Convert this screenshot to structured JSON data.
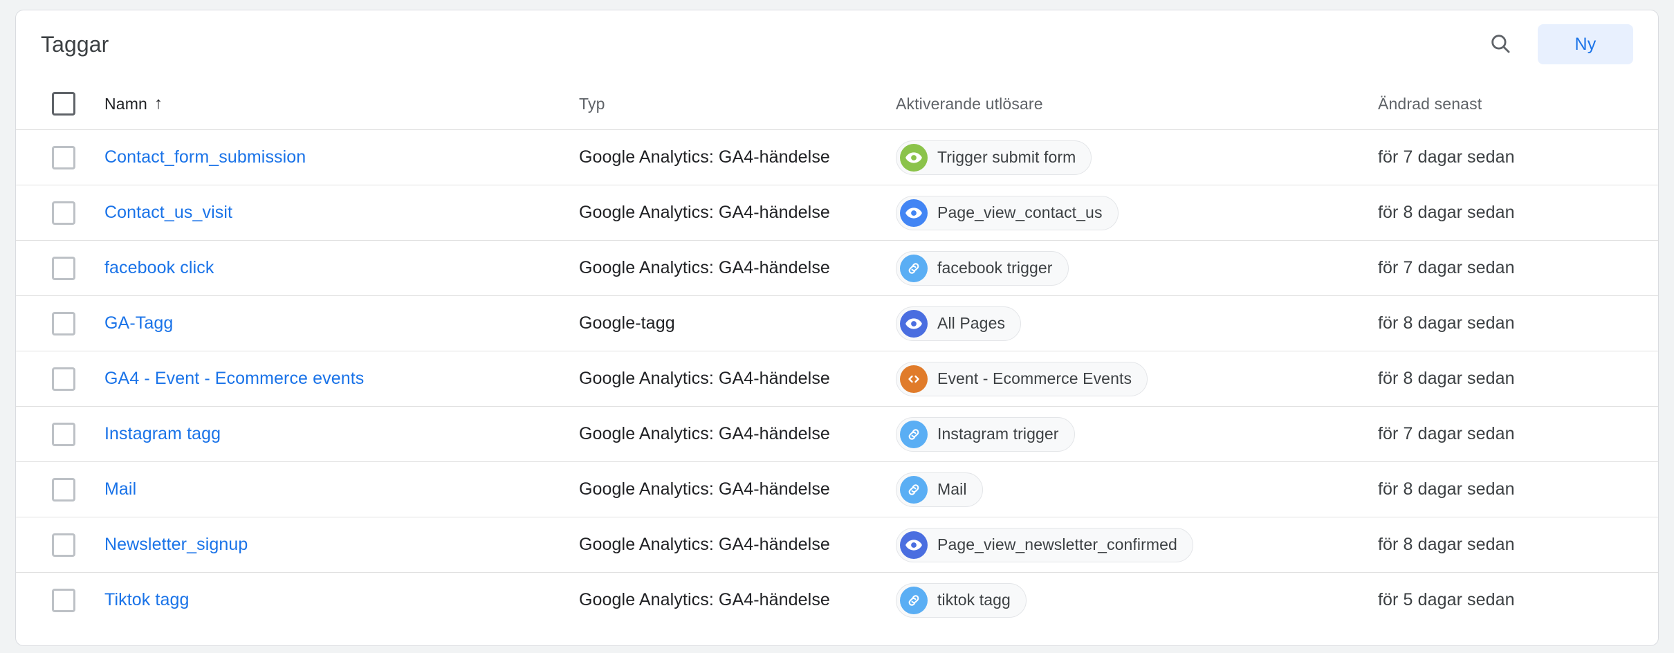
{
  "header": {
    "title": "Taggar",
    "search_icon": "search-icon",
    "new_button_label": "Ny"
  },
  "table": {
    "columns": {
      "name": "Namn",
      "type": "Typ",
      "trigger": "Aktiverande utlösare",
      "modified": "Ändrad senast"
    },
    "sort": {
      "column": "name",
      "direction": "asc",
      "arrow_glyph": "↑"
    },
    "select_all_checked": false,
    "rows": [
      {
        "name": "Contact_form_submission",
        "type": "Google Analytics: GA4-händelse",
        "trigger": {
          "label": "Trigger submit form",
          "icon": "eye-icon",
          "color": "#8bc34a"
        },
        "modified": "för 7 dagar sedan",
        "checked": false
      },
      {
        "name": "Contact_us_visit",
        "type": "Google Analytics: GA4-händelse",
        "trigger": {
          "label": "Page_view_contact_us",
          "icon": "eye-icon",
          "color": "#4285f4"
        },
        "modified": "för 8 dagar sedan",
        "checked": false
      },
      {
        "name": "facebook click",
        "type": "Google Analytics: GA4-händelse",
        "trigger": {
          "label": "facebook trigger",
          "icon": "link-icon",
          "color": "#5aaef4"
        },
        "modified": "för 7 dagar sedan",
        "checked": false
      },
      {
        "name": "GA-Tagg",
        "type": "Google-tagg",
        "trigger": {
          "label": "All Pages",
          "icon": "eye-icon",
          "color": "#4a6ee0"
        },
        "modified": "för 8 dagar sedan",
        "checked": false
      },
      {
        "name": "GA4 - Event - Ecommerce events",
        "type": "Google Analytics: GA4-händelse",
        "trigger": {
          "label": "Event - Ecommerce Events",
          "icon": "code-icon",
          "color": "#e07b2a"
        },
        "modified": "för 8 dagar sedan",
        "checked": false
      },
      {
        "name": "Instagram tagg",
        "type": "Google Analytics: GA4-händelse",
        "trigger": {
          "label": "Instagram trigger",
          "icon": "link-icon",
          "color": "#5aaef4"
        },
        "modified": "för 7 dagar sedan",
        "checked": false
      },
      {
        "name": "Mail",
        "type": "Google Analytics: GA4-händelse",
        "trigger": {
          "label": "Mail",
          "icon": "link-icon",
          "color": "#5aaef4"
        },
        "modified": "för 8 dagar sedan",
        "checked": false
      },
      {
        "name": "Newsletter_signup",
        "type": "Google Analytics: GA4-händelse",
        "trigger": {
          "label": "Page_view_newsletter_confirmed",
          "icon": "eye-icon",
          "color": "#4a6ee0"
        },
        "modified": "för 8 dagar sedan",
        "checked": false
      },
      {
        "name": "Tiktok tagg",
        "type": "Google Analytics: GA4-händelse",
        "trigger": {
          "label": "tiktok tagg",
          "icon": "link-icon",
          "color": "#5aaef4"
        },
        "modified": "för 5 dagar sedan",
        "checked": false
      }
    ]
  },
  "colors": {
    "link": "#1a73e8",
    "accent_bg": "#e8f0fe",
    "page_bg": "#f1f3f4",
    "border": "#dadce0"
  }
}
